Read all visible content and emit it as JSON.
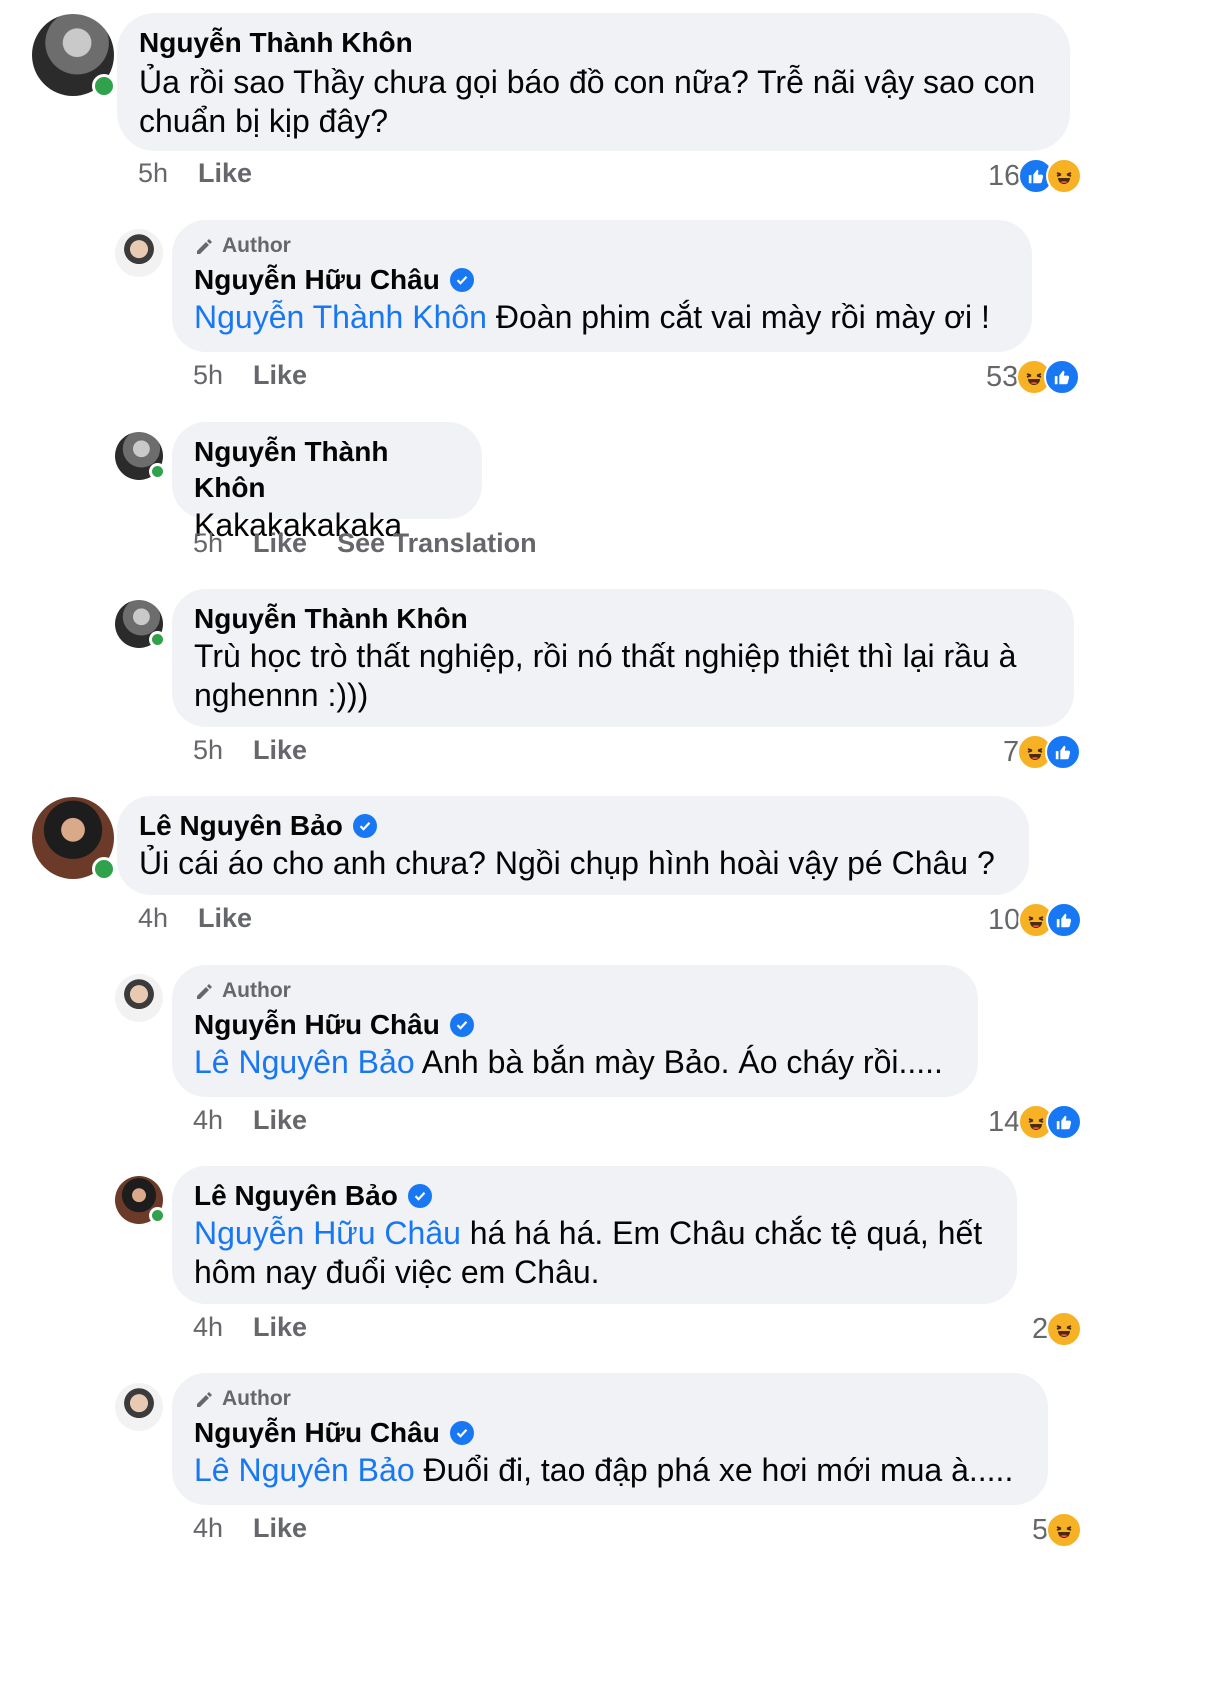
{
  "comments": [
    {
      "author": "Nguyễn Thành Khôn",
      "verified": false,
      "author_badge": "",
      "mention": "",
      "text": "Ủa rồi sao Thầy chưa gọi báo đồ con nữa? Trễ nãi vậy sao con chuẩn bị kịp đây?",
      "time": "5h",
      "actions": [
        "Like"
      ],
      "reaction_count": "16",
      "reactions": [
        "like",
        "haha"
      ]
    },
    {
      "author": "Nguyễn Hữu Châu",
      "verified": true,
      "author_badge": "Author",
      "mention": "Nguyễn Thành Khôn",
      "text": "Đoàn phim cắt vai mày rồi mày ơi !",
      "time": "5h",
      "actions": [
        "Like"
      ],
      "reaction_count": "53",
      "reactions": [
        "haha",
        "like"
      ]
    },
    {
      "author": "Nguyễn Thành Khôn",
      "verified": false,
      "author_badge": "",
      "mention": "",
      "text": "Kakakakakaka",
      "time": "5h",
      "actions": [
        "Like",
        "See Translation"
      ],
      "reaction_count": "",
      "reactions": []
    },
    {
      "author": "Nguyễn Thành Khôn",
      "verified": false,
      "author_badge": "",
      "mention": "",
      "text": "Trù học trò thất nghiệp, rồi nó thất nghiệp thiệt thì lại rầu à nghennn :)))",
      "time": "5h",
      "actions": [
        "Like"
      ],
      "reaction_count": "7",
      "reactions": [
        "haha",
        "like"
      ]
    },
    {
      "author": "Lê Nguyên Bảo",
      "verified": true,
      "author_badge": "",
      "mention": "",
      "text": "Ủi cái áo cho anh chưa? Ngồi chụp hình hoài vậy pé Châu ?",
      "time": "4h",
      "actions": [
        "Like"
      ],
      "reaction_count": "10",
      "reactions": [
        "haha",
        "like"
      ]
    },
    {
      "author": "Nguyễn Hữu Châu",
      "verified": true,
      "author_badge": "Author",
      "mention": "Lê Nguyên Bảo",
      "text": "Anh bà bắn mày Bảo. Áo cháy rồi.....",
      "time": "4h",
      "actions": [
        "Like"
      ],
      "reaction_count": "14",
      "reactions": [
        "haha",
        "like"
      ]
    },
    {
      "author": "Lê Nguyên Bảo",
      "verified": true,
      "author_badge": "",
      "mention": "Nguyễn Hữu Châu",
      "text": "há há há. Em Châu chắc tệ quá, hết hôm nay đuổi việc em Châu.",
      "time": "4h",
      "actions": [
        "Like"
      ],
      "reaction_count": "2",
      "reactions": [
        "haha"
      ]
    },
    {
      "author": "Nguyễn Hữu Châu",
      "verified": true,
      "author_badge": "Author",
      "mention": "Lê Nguyên Bảo",
      "text": "Đuổi đi, tao đập phá xe hơi mới mua à.....",
      "time": "4h",
      "actions": [
        "Like"
      ],
      "reaction_count": "5",
      "reactions": [
        "haha"
      ]
    }
  ],
  "colors": {
    "mention": "#1877f2",
    "bubble": "#f0f2f5",
    "online": "#31a24c",
    "like": "#1877f2",
    "haha": "#f7b125"
  }
}
